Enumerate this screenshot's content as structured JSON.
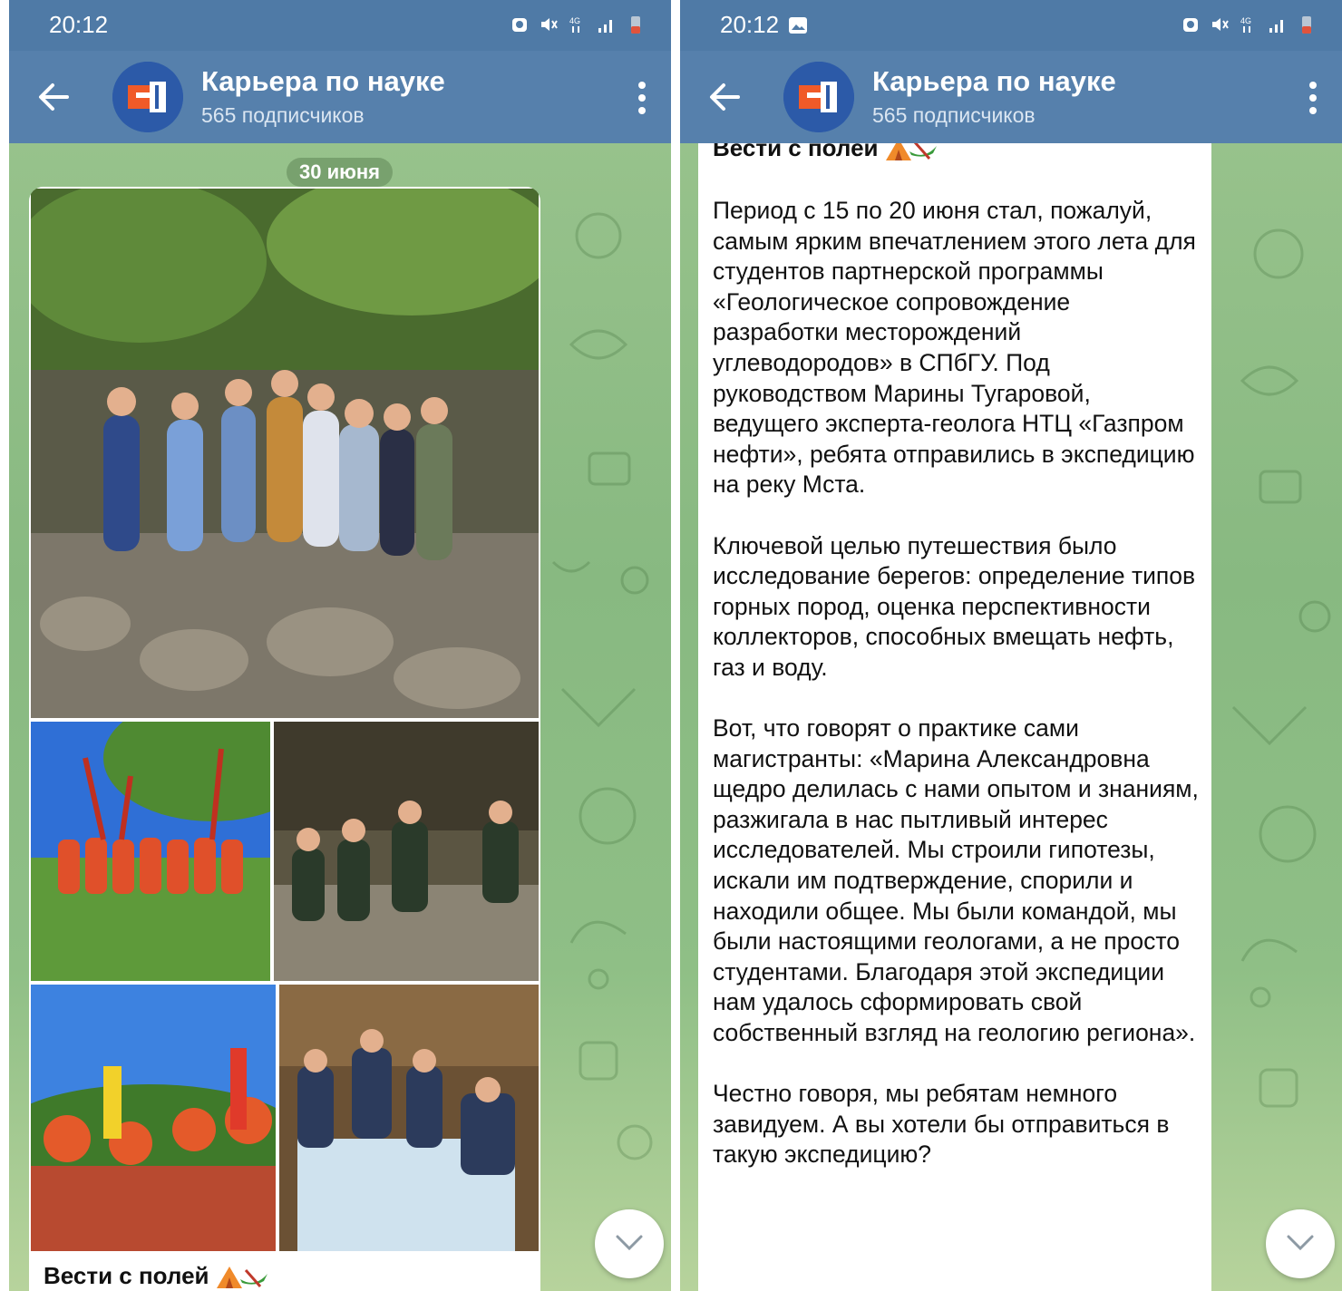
{
  "left_screen": {
    "status": {
      "time": "20:12"
    },
    "header": {
      "title": "Карьера по науке",
      "subtitle": "565 подписчиков"
    },
    "date_label": "30 июня",
    "caption_title": "Вести с полей"
  },
  "right_screen": {
    "status": {
      "time": "20:12"
    },
    "header": {
      "title": "Карьера по науке",
      "subtitle": "565 подписчиков"
    },
    "post": {
      "title": "Вести с полей",
      "paragraphs": [
        "Период с 15 по 20 июня стал, пожалуй, самым ярким впечатлением этого лета для студентов партнерской программы «Геологическое сопровождение разработки месторождений углеводородов» в СПбГУ. Под руководством Марины Тугаровой, ведущего эксперта-геолога НТЦ «Газпром нефти», ребята отправились в экспедицию на реку Мста.",
        "Ключевой целью путешествия было исследование берегов: определение типов горных пород, оценка перспективности коллекторов, способных вмещать нефть, газ и воду.",
        "Вот, что говорят о практике сами магистранты: «Марина Александровна щедро делилась с нами опытом и знаниям, разжигала в нас пытливый интерес исследователей. Мы строили гипотезы, искали им подтверждение, спорили и находили общее. Мы были командой, мы были настоящими геологами, а не просто студентами. Благодаря этой экспедиции нам удалось сформировать свой собственный взгляд на геологию региона».",
        "Честно говоря, мы ребятам немного завидуем. А вы хотели бы отправиться в такую экспедицию?"
      ]
    }
  },
  "colors": {
    "statusbar": "#4f7aa6",
    "appbar": "#5680ac",
    "wallpaper": "#8fbf86",
    "bubble": "#ffffff"
  },
  "icons": [
    "back-arrow-icon",
    "channel-avatar",
    "more-vert-icon",
    "alarm-icon",
    "mute-icon",
    "4g-icon",
    "signal-icon",
    "battery-icon",
    "image-notification-icon",
    "chevron-down-icon",
    "tent-emoji-icon",
    "canoe-emoji-icon"
  ]
}
